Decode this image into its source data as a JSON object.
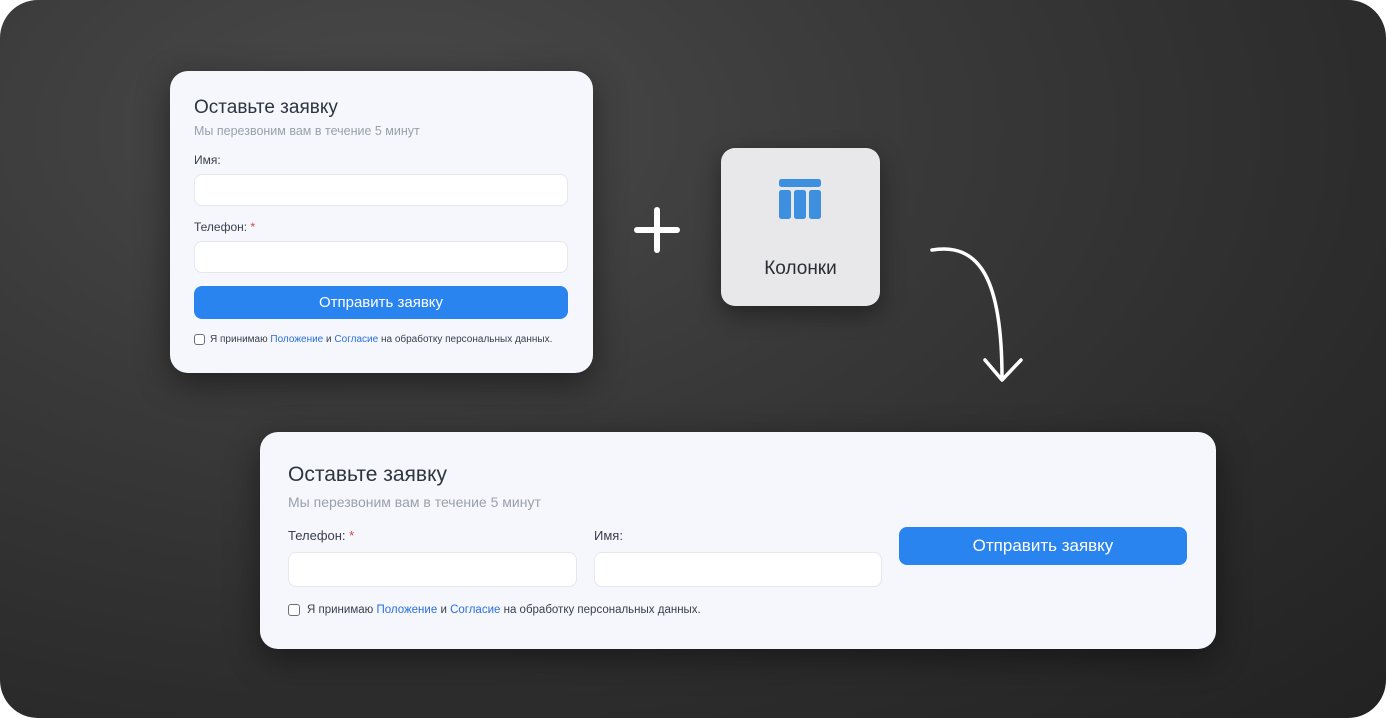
{
  "small_form": {
    "title": "Оставьте заявку",
    "subtitle": "Мы перезвоним вам в течение 5 минут",
    "name_label": "Имя:",
    "phone_label": "Телефон:",
    "required_mark": "*",
    "submit_label": "Отправить заявку",
    "consent_prefix": "Я принимаю",
    "consent_link_1": "Положение",
    "consent_and": "и",
    "consent_link_2": "Согласие",
    "consent_suffix": "на обработку персональных данных."
  },
  "block_tile": {
    "label": "Колонки",
    "icon": "columns-icon",
    "icon_color": "#3d8fe0"
  },
  "big_form": {
    "title": "Оставьте заявку",
    "subtitle": "Мы перезвоним вам в течение 5 минут",
    "phone_label": "Телефон:",
    "required_mark": "*",
    "name_label": "Имя:",
    "submit_label": "Отправить заявку",
    "consent_prefix": "Я принимаю",
    "consent_link_1": "Положение",
    "consent_and": "и",
    "consent_link_2": "Согласие",
    "consent_suffix": "на обработку персональных данных."
  },
  "colors": {
    "button": "#2a84f0",
    "link": "#2a6fdb",
    "card_bg": "#f5f7fc",
    "background": "#333333"
  },
  "decorations": {
    "plus": "plus-icon",
    "arrow": "curved-arrow-down-icon"
  }
}
